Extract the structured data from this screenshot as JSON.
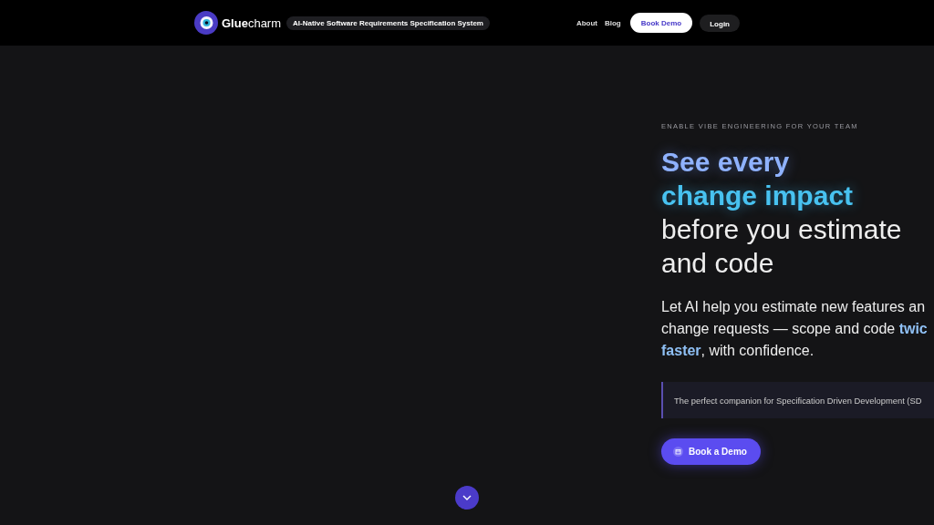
{
  "nav": {
    "brand_first": "Glue",
    "brand_second": "charm",
    "tagline": "AI-Native Software Requirements Specification System",
    "links": [
      "About",
      "Blog"
    ],
    "buttons": [
      {
        "label": "Book Demo",
        "kind": "primary"
      },
      {
        "label": "Login",
        "kind": "secondary"
      }
    ]
  },
  "hero": {
    "eyebrow": "ENABLE VIBE ENGINEERING FOR YOUR TEAM",
    "heading": [
      {
        "text": "See every",
        "kind": "accent1"
      },
      {
        "text": "change impact",
        "kind": "accent2"
      },
      {
        "text": "before you estimate",
        "kind": "plain"
      },
      {
        "text": "and code",
        "kind": "plain"
      }
    ],
    "lead_lines": [
      "Let AI help you estimate new features an",
      "change requests — scope and code **twic**",
      "**faster**, with confidence."
    ],
    "callout": "The perfect companion for Specification Driven Development (SD",
    "cta": "Book a Demo"
  }
}
